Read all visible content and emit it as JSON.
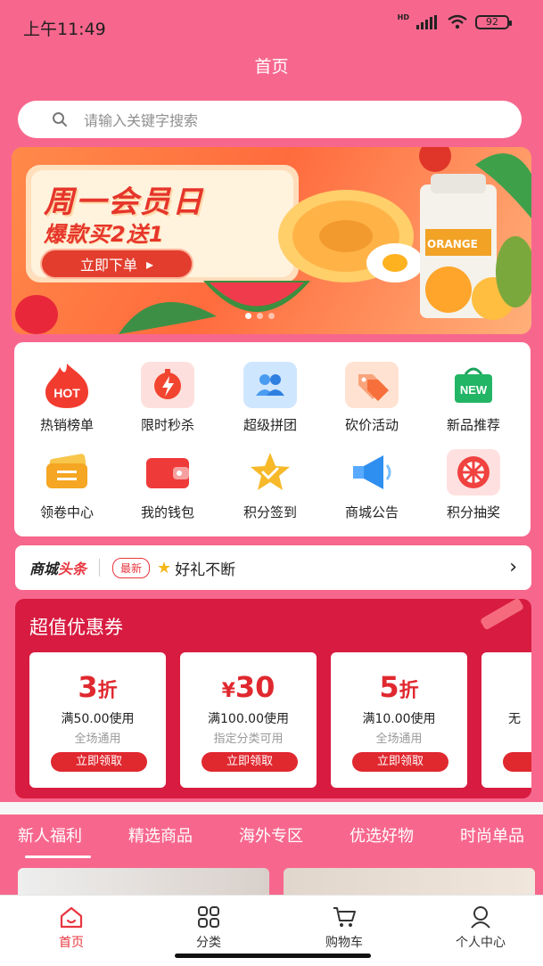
{
  "status_bar": {
    "time": "上午11:49",
    "hd": "HD",
    "battery": "92"
  },
  "page_title": "首页",
  "search": {
    "placeholder": "请输入关键字搜索"
  },
  "banner": {
    "title": "周一会员日",
    "subtitle": "爆款买2送1",
    "button": "立即下单",
    "button_arrow": "▸",
    "slide_count": 3,
    "active_slide": 1,
    "product_label": "ORANGE"
  },
  "menu": {
    "items": [
      {
        "label": "热销榜单",
        "icon": "hot-icon",
        "badge": "HOT"
      },
      {
        "label": "限时秒杀",
        "icon": "flash-sale-icon"
      },
      {
        "label": "超级拼团",
        "icon": "group-buy-icon"
      },
      {
        "label": "砍价活动",
        "icon": "bargain-tag-icon"
      },
      {
        "label": "新品推荐",
        "icon": "new-bag-icon",
        "badge": "NEW"
      },
      {
        "label": "领卷中心",
        "icon": "coupon-ticket-icon"
      },
      {
        "label": "我的钱包",
        "icon": "wallet-icon"
      },
      {
        "label": "积分签到",
        "icon": "star-checkin-icon"
      },
      {
        "label": "商城公告",
        "icon": "megaphone-icon"
      },
      {
        "label": "积分抽奖",
        "icon": "lottery-wheel-icon"
      }
    ]
  },
  "news": {
    "brand_a": "商城",
    "brand_b": "头条",
    "tag": "最新",
    "star": "★",
    "text": "好礼不断",
    "arrow": "›"
  },
  "coupons": {
    "title": "超值优惠券",
    "items": [
      {
        "amount": "3",
        "unit": "折",
        "condition": "满50.00使用",
        "scope": "全场通用",
        "button": "立即领取"
      },
      {
        "unit_prefix": "¥",
        "amount": "30",
        "condition": "满100.00使用",
        "scope": "指定分类可用",
        "button": "立即领取"
      },
      {
        "amount": "5",
        "unit": "折",
        "condition": "满10.00使用",
        "scope": "全场通用",
        "button": "立即领取"
      },
      {
        "condition": "无"
      }
    ]
  },
  "tabs": [
    {
      "label": "新人福利",
      "active": true
    },
    {
      "label": "精选商品"
    },
    {
      "label": "海外专区"
    },
    {
      "label": "优选好物"
    },
    {
      "label": "时尚单品"
    }
  ],
  "bottom_nav": [
    {
      "label": "首页",
      "icon": "home-icon",
      "active": true
    },
    {
      "label": "分类",
      "icon": "grid-icon"
    },
    {
      "label": "购物车",
      "icon": "cart-icon"
    },
    {
      "label": "个人中心",
      "icon": "user-icon"
    }
  ],
  "colors": {
    "brand_pink": "#f7678d",
    "accent_red": "#e8363f",
    "coupon_red": "#d81b40"
  }
}
